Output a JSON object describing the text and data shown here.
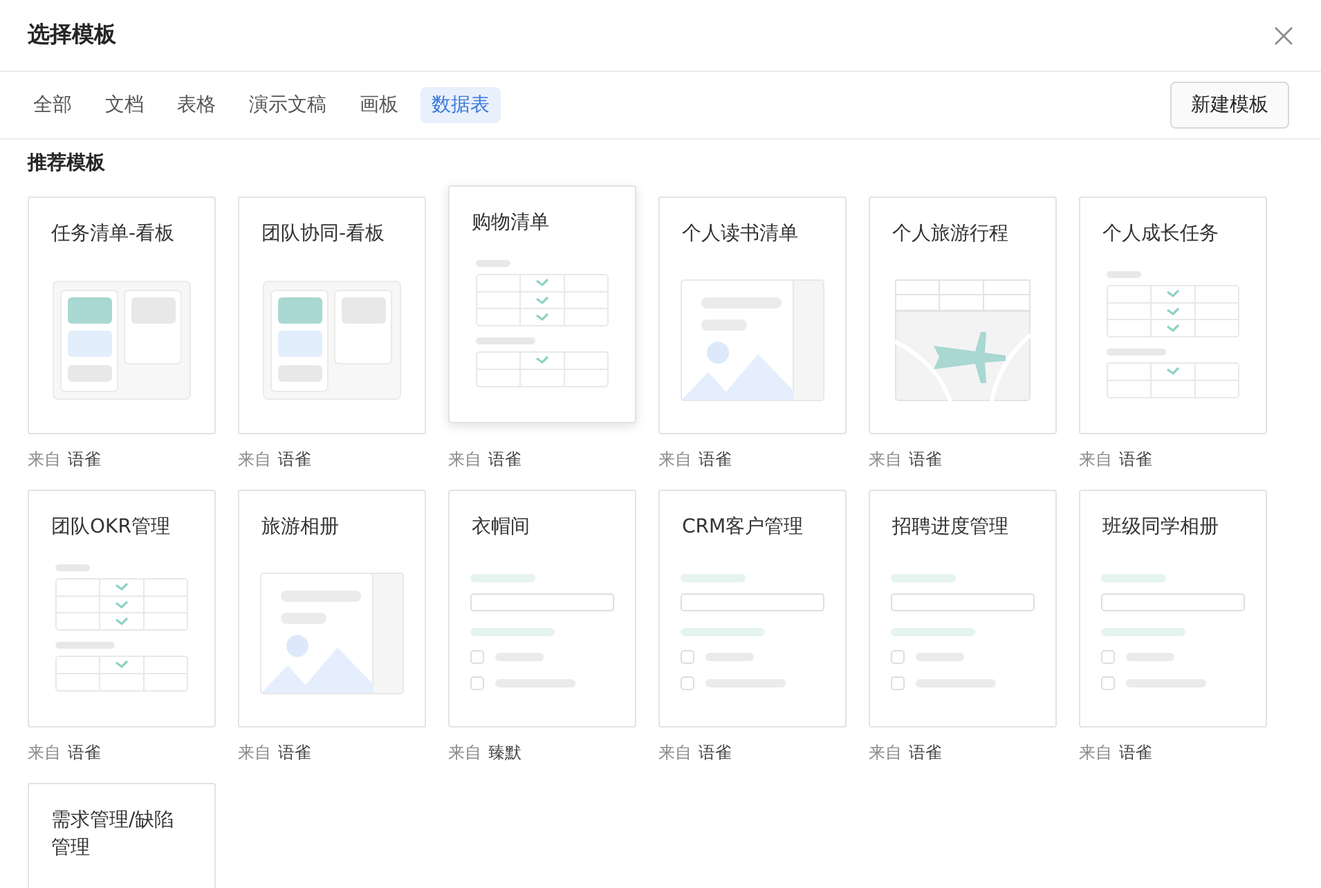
{
  "dialog": {
    "title": "选择模板"
  },
  "tabs": [
    {
      "label": "全部",
      "selected": false
    },
    {
      "label": "文档",
      "selected": false
    },
    {
      "label": "表格",
      "selected": false
    },
    {
      "label": "演示文稿",
      "selected": false
    },
    {
      "label": "画板",
      "selected": false
    },
    {
      "label": "数据表",
      "selected": true
    }
  ],
  "new_template_button": "新建模板",
  "section_title": "推荐模板",
  "templates": [
    {
      "title": "任务清单-看板",
      "kind": "kanban",
      "highlighted": false,
      "source_prefix": "来自",
      "source": "语雀"
    },
    {
      "title": "团队协同-看板",
      "kind": "kanban",
      "highlighted": false,
      "source_prefix": "来自",
      "source": "语雀"
    },
    {
      "title": "购物清单",
      "kind": "checklist",
      "highlighted": true,
      "source_prefix": "来自",
      "source": "语雀"
    },
    {
      "title": "个人读书清单",
      "kind": "gallery",
      "highlighted": false,
      "source_prefix": "来自",
      "source": "语雀"
    },
    {
      "title": "个人旅游行程",
      "kind": "map",
      "highlighted": false,
      "source_prefix": "来自",
      "source": "语雀"
    },
    {
      "title": "个人成长任务",
      "kind": "checklist",
      "highlighted": false,
      "source_prefix": "来自",
      "source": "语雀"
    },
    {
      "title": "团队OKR管理",
      "kind": "checklist",
      "highlighted": false,
      "source_prefix": "来自",
      "source": "语雀"
    },
    {
      "title": "旅游相册",
      "kind": "gallery",
      "highlighted": false,
      "source_prefix": "来自",
      "source": "语雀"
    },
    {
      "title": "衣帽间",
      "kind": "form",
      "highlighted": false,
      "source_prefix": "来自",
      "source": "臻默"
    },
    {
      "title": "CRM客户管理",
      "kind": "form",
      "highlighted": false,
      "source_prefix": "来自",
      "source": "语雀"
    },
    {
      "title": "招聘进度管理",
      "kind": "form",
      "highlighted": false,
      "source_prefix": "来自",
      "source": "语雀"
    },
    {
      "title": "班级同学相册",
      "kind": "form",
      "highlighted": false,
      "source_prefix": "来自",
      "source": "语雀"
    },
    {
      "title": "需求管理/缺陷管理",
      "kind": "none",
      "highlighted": false
    }
  ]
}
